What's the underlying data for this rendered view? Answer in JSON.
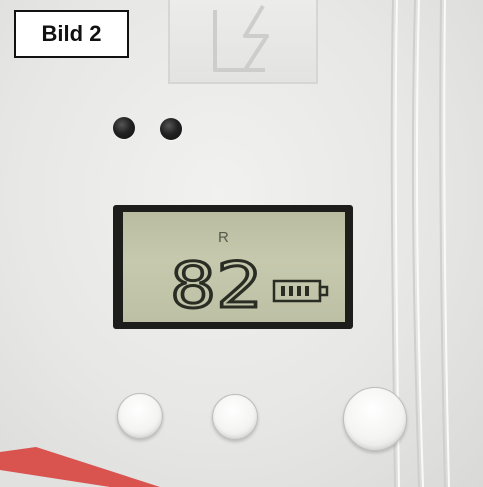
{
  "caption": {
    "label": "Bild 2"
  },
  "lcd": {
    "indicator": "R",
    "reading": "82",
    "battery_icon": "battery-icon",
    "battery_bars": 4
  },
  "icons": {
    "logo": "logo-icon",
    "led": "led-icon"
  },
  "colors": {
    "housing": "#e7e7e5",
    "lcd_background": "#c3c6aa",
    "segment": "#2a2d24",
    "arrow": "#d9534f"
  }
}
